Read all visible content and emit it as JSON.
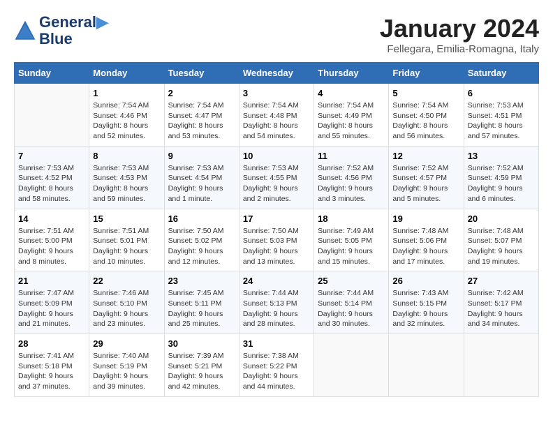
{
  "header": {
    "logo_line1": "General",
    "logo_line2": "Blue",
    "month": "January 2024",
    "location": "Fellegara, Emilia-Romagna, Italy"
  },
  "days_of_week": [
    "Sunday",
    "Monday",
    "Tuesday",
    "Wednesday",
    "Thursday",
    "Friday",
    "Saturday"
  ],
  "weeks": [
    [
      {
        "day": "",
        "info": ""
      },
      {
        "day": "1",
        "info": "Sunrise: 7:54 AM\nSunset: 4:46 PM\nDaylight: 8 hours\nand 52 minutes."
      },
      {
        "day": "2",
        "info": "Sunrise: 7:54 AM\nSunset: 4:47 PM\nDaylight: 8 hours\nand 53 minutes."
      },
      {
        "day": "3",
        "info": "Sunrise: 7:54 AM\nSunset: 4:48 PM\nDaylight: 8 hours\nand 54 minutes."
      },
      {
        "day": "4",
        "info": "Sunrise: 7:54 AM\nSunset: 4:49 PM\nDaylight: 8 hours\nand 55 minutes."
      },
      {
        "day": "5",
        "info": "Sunrise: 7:54 AM\nSunset: 4:50 PM\nDaylight: 8 hours\nand 56 minutes."
      },
      {
        "day": "6",
        "info": "Sunrise: 7:53 AM\nSunset: 4:51 PM\nDaylight: 8 hours\nand 57 minutes."
      }
    ],
    [
      {
        "day": "7",
        "info": "Sunrise: 7:53 AM\nSunset: 4:52 PM\nDaylight: 8 hours\nand 58 minutes."
      },
      {
        "day": "8",
        "info": "Sunrise: 7:53 AM\nSunset: 4:53 PM\nDaylight: 8 hours\nand 59 minutes."
      },
      {
        "day": "9",
        "info": "Sunrise: 7:53 AM\nSunset: 4:54 PM\nDaylight: 9 hours\nand 1 minute."
      },
      {
        "day": "10",
        "info": "Sunrise: 7:53 AM\nSunset: 4:55 PM\nDaylight: 9 hours\nand 2 minutes."
      },
      {
        "day": "11",
        "info": "Sunrise: 7:52 AM\nSunset: 4:56 PM\nDaylight: 9 hours\nand 3 minutes."
      },
      {
        "day": "12",
        "info": "Sunrise: 7:52 AM\nSunset: 4:57 PM\nDaylight: 9 hours\nand 5 minutes."
      },
      {
        "day": "13",
        "info": "Sunrise: 7:52 AM\nSunset: 4:59 PM\nDaylight: 9 hours\nand 6 minutes."
      }
    ],
    [
      {
        "day": "14",
        "info": "Sunrise: 7:51 AM\nSunset: 5:00 PM\nDaylight: 9 hours\nand 8 minutes."
      },
      {
        "day": "15",
        "info": "Sunrise: 7:51 AM\nSunset: 5:01 PM\nDaylight: 9 hours\nand 10 minutes."
      },
      {
        "day": "16",
        "info": "Sunrise: 7:50 AM\nSunset: 5:02 PM\nDaylight: 9 hours\nand 12 minutes."
      },
      {
        "day": "17",
        "info": "Sunrise: 7:50 AM\nSunset: 5:03 PM\nDaylight: 9 hours\nand 13 minutes."
      },
      {
        "day": "18",
        "info": "Sunrise: 7:49 AM\nSunset: 5:05 PM\nDaylight: 9 hours\nand 15 minutes."
      },
      {
        "day": "19",
        "info": "Sunrise: 7:48 AM\nSunset: 5:06 PM\nDaylight: 9 hours\nand 17 minutes."
      },
      {
        "day": "20",
        "info": "Sunrise: 7:48 AM\nSunset: 5:07 PM\nDaylight: 9 hours\nand 19 minutes."
      }
    ],
    [
      {
        "day": "21",
        "info": "Sunrise: 7:47 AM\nSunset: 5:09 PM\nDaylight: 9 hours\nand 21 minutes."
      },
      {
        "day": "22",
        "info": "Sunrise: 7:46 AM\nSunset: 5:10 PM\nDaylight: 9 hours\nand 23 minutes."
      },
      {
        "day": "23",
        "info": "Sunrise: 7:45 AM\nSunset: 5:11 PM\nDaylight: 9 hours\nand 25 minutes."
      },
      {
        "day": "24",
        "info": "Sunrise: 7:44 AM\nSunset: 5:13 PM\nDaylight: 9 hours\nand 28 minutes."
      },
      {
        "day": "25",
        "info": "Sunrise: 7:44 AM\nSunset: 5:14 PM\nDaylight: 9 hours\nand 30 minutes."
      },
      {
        "day": "26",
        "info": "Sunrise: 7:43 AM\nSunset: 5:15 PM\nDaylight: 9 hours\nand 32 minutes."
      },
      {
        "day": "27",
        "info": "Sunrise: 7:42 AM\nSunset: 5:17 PM\nDaylight: 9 hours\nand 34 minutes."
      }
    ],
    [
      {
        "day": "28",
        "info": "Sunrise: 7:41 AM\nSunset: 5:18 PM\nDaylight: 9 hours\nand 37 minutes."
      },
      {
        "day": "29",
        "info": "Sunrise: 7:40 AM\nSunset: 5:19 PM\nDaylight: 9 hours\nand 39 minutes."
      },
      {
        "day": "30",
        "info": "Sunrise: 7:39 AM\nSunset: 5:21 PM\nDaylight: 9 hours\nand 42 minutes."
      },
      {
        "day": "31",
        "info": "Sunrise: 7:38 AM\nSunset: 5:22 PM\nDaylight: 9 hours\nand 44 minutes."
      },
      {
        "day": "",
        "info": ""
      },
      {
        "day": "",
        "info": ""
      },
      {
        "day": "",
        "info": ""
      }
    ]
  ]
}
